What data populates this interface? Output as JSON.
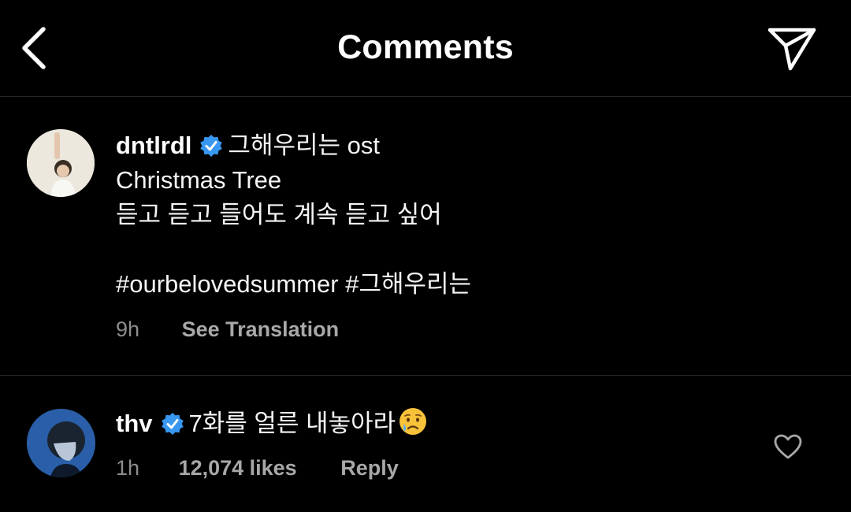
{
  "header": {
    "title": "Comments",
    "back_icon": "chevron-left-icon",
    "send_icon": "paper-plane-icon"
  },
  "caption": {
    "username": "dntlrdl",
    "verified": true,
    "text_first": "그해우리는 ost",
    "text_second": "Christmas Tree",
    "text_third": "듣고 듣고 들어도 계속 듣고 싶어",
    "hashtags": "#ourbelovedsummer #그해우리는",
    "time": "9h",
    "translate_label": "See Translation"
  },
  "comments": [
    {
      "username": "thv",
      "verified": true,
      "text": "7화를 얼른 내놓아라",
      "emoji": "crying-face-emoji",
      "time": "1h",
      "likes": "12,074 likes",
      "reply_label": "Reply"
    }
  ],
  "colors": {
    "background": "#000000",
    "text": "#ffffff",
    "secondary_text": "#8e8e8e",
    "verified_blue": "#3897f0",
    "divider": "#262626"
  }
}
